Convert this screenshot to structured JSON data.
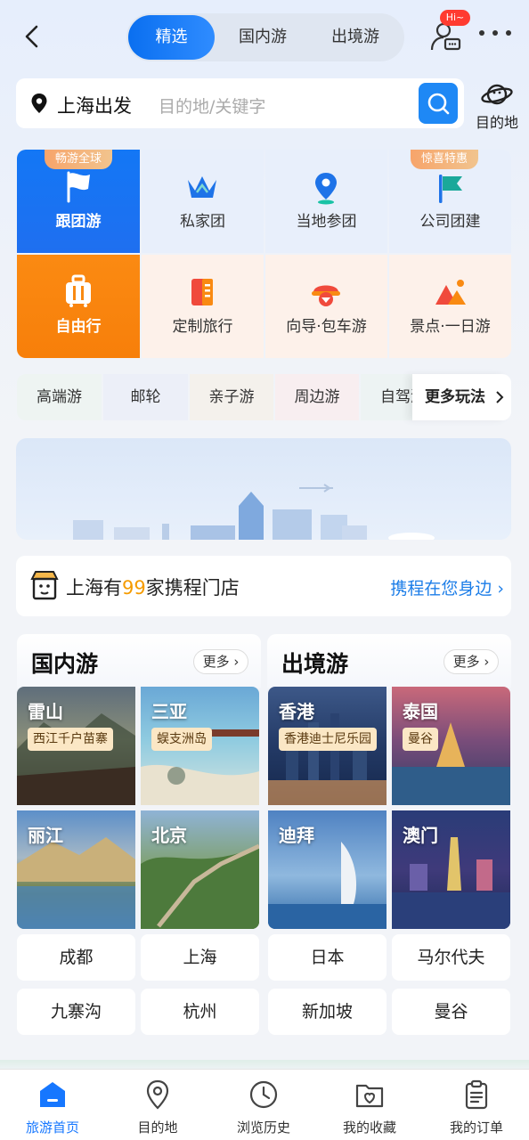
{
  "header": {
    "tabs": [
      {
        "label": "精选",
        "active": true
      },
      {
        "label": "国内游",
        "active": false
      },
      {
        "label": "出境游",
        "active": false
      }
    ],
    "hi_badge": "Hi~"
  },
  "search": {
    "departure": "上海出发",
    "placeholder": "目的地/关键字",
    "destination_label": "目的地"
  },
  "categories": [
    {
      "label": "跟团游",
      "icon": "flag-icon",
      "ribbon": "畅游全球"
    },
    {
      "label": "私家团",
      "icon": "crown-icon"
    },
    {
      "label": "当地参团",
      "icon": "location-pin-icon"
    },
    {
      "label": "公司团建",
      "icon": "team-flag-icon",
      "ribbon": "惊喜特惠"
    },
    {
      "label": "自由行",
      "icon": "luggage-icon"
    },
    {
      "label": "定制旅行",
      "icon": "custom-notebook-icon"
    },
    {
      "label": "向导·包车游",
      "icon": "guide-cap-icon"
    },
    {
      "label": "景点·一日游",
      "icon": "mountain-icon"
    }
  ],
  "chips": [
    "高端游",
    "邮轮",
    "亲子游",
    "周边游",
    "自驾游"
  ],
  "more_play": "更多玩法",
  "store": {
    "prefix": "上海有",
    "count": "99",
    "suffix": "家携程门店",
    "link": "携程在您身边"
  },
  "domestic": {
    "title": "国内游",
    "more": "更多",
    "tiles": [
      {
        "city": "雷山",
        "tag": "西江千户苗寨"
      },
      {
        "city": "三亚",
        "tag": "蜈支洲岛"
      },
      {
        "city": "丽江",
        "tag": ""
      },
      {
        "city": "北京",
        "tag": ""
      }
    ],
    "cities": [
      "成都",
      "上海",
      "九寨沟",
      "杭州"
    ]
  },
  "outbound": {
    "title": "出境游",
    "more": "更多",
    "tiles": [
      {
        "city": "香港",
        "tag": "香港迪士尼乐园"
      },
      {
        "city": "泰国",
        "tag": "曼谷"
      },
      {
        "city": "迪拜",
        "tag": ""
      },
      {
        "city": "澳门",
        "tag": ""
      }
    ],
    "cities": [
      "日本",
      "马尔代夫",
      "新加坡",
      "曼谷"
    ]
  },
  "tabbar": [
    {
      "label": "旅游首页",
      "active": true
    },
    {
      "label": "目的地",
      "active": false
    },
    {
      "label": "浏览历史",
      "active": false
    },
    {
      "label": "我的收藏",
      "active": false
    },
    {
      "label": "我的订单",
      "active": false
    }
  ],
  "colors": {
    "accent": "#1677ff",
    "orange": "#f98a12",
    "highlight": "#f59b00"
  }
}
